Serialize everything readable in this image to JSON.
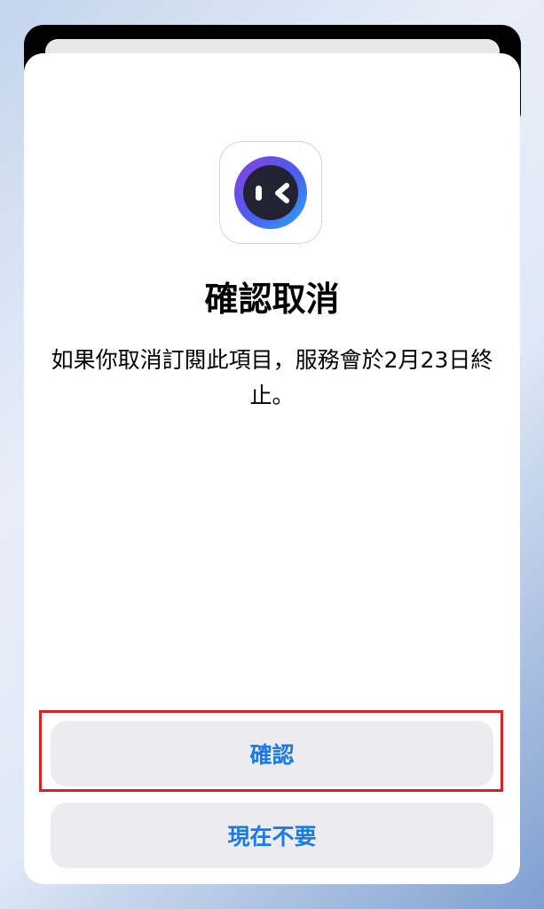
{
  "dialog": {
    "title": "確認取消",
    "message": "如果你取消訂閱此項目，服務會於2月23日終止。",
    "confirm_label": "確認",
    "not_now_label": "現在不要"
  },
  "app_icon": {
    "name": "app-logo-icon",
    "ring_colors": [
      "#7b3fe4",
      "#3a6ff0",
      "#2ea8f5"
    ],
    "face_color": "#222233"
  },
  "colors": {
    "accent": "#1a7ae6",
    "button_bg": "#ececf0",
    "highlight": "#e02020"
  }
}
